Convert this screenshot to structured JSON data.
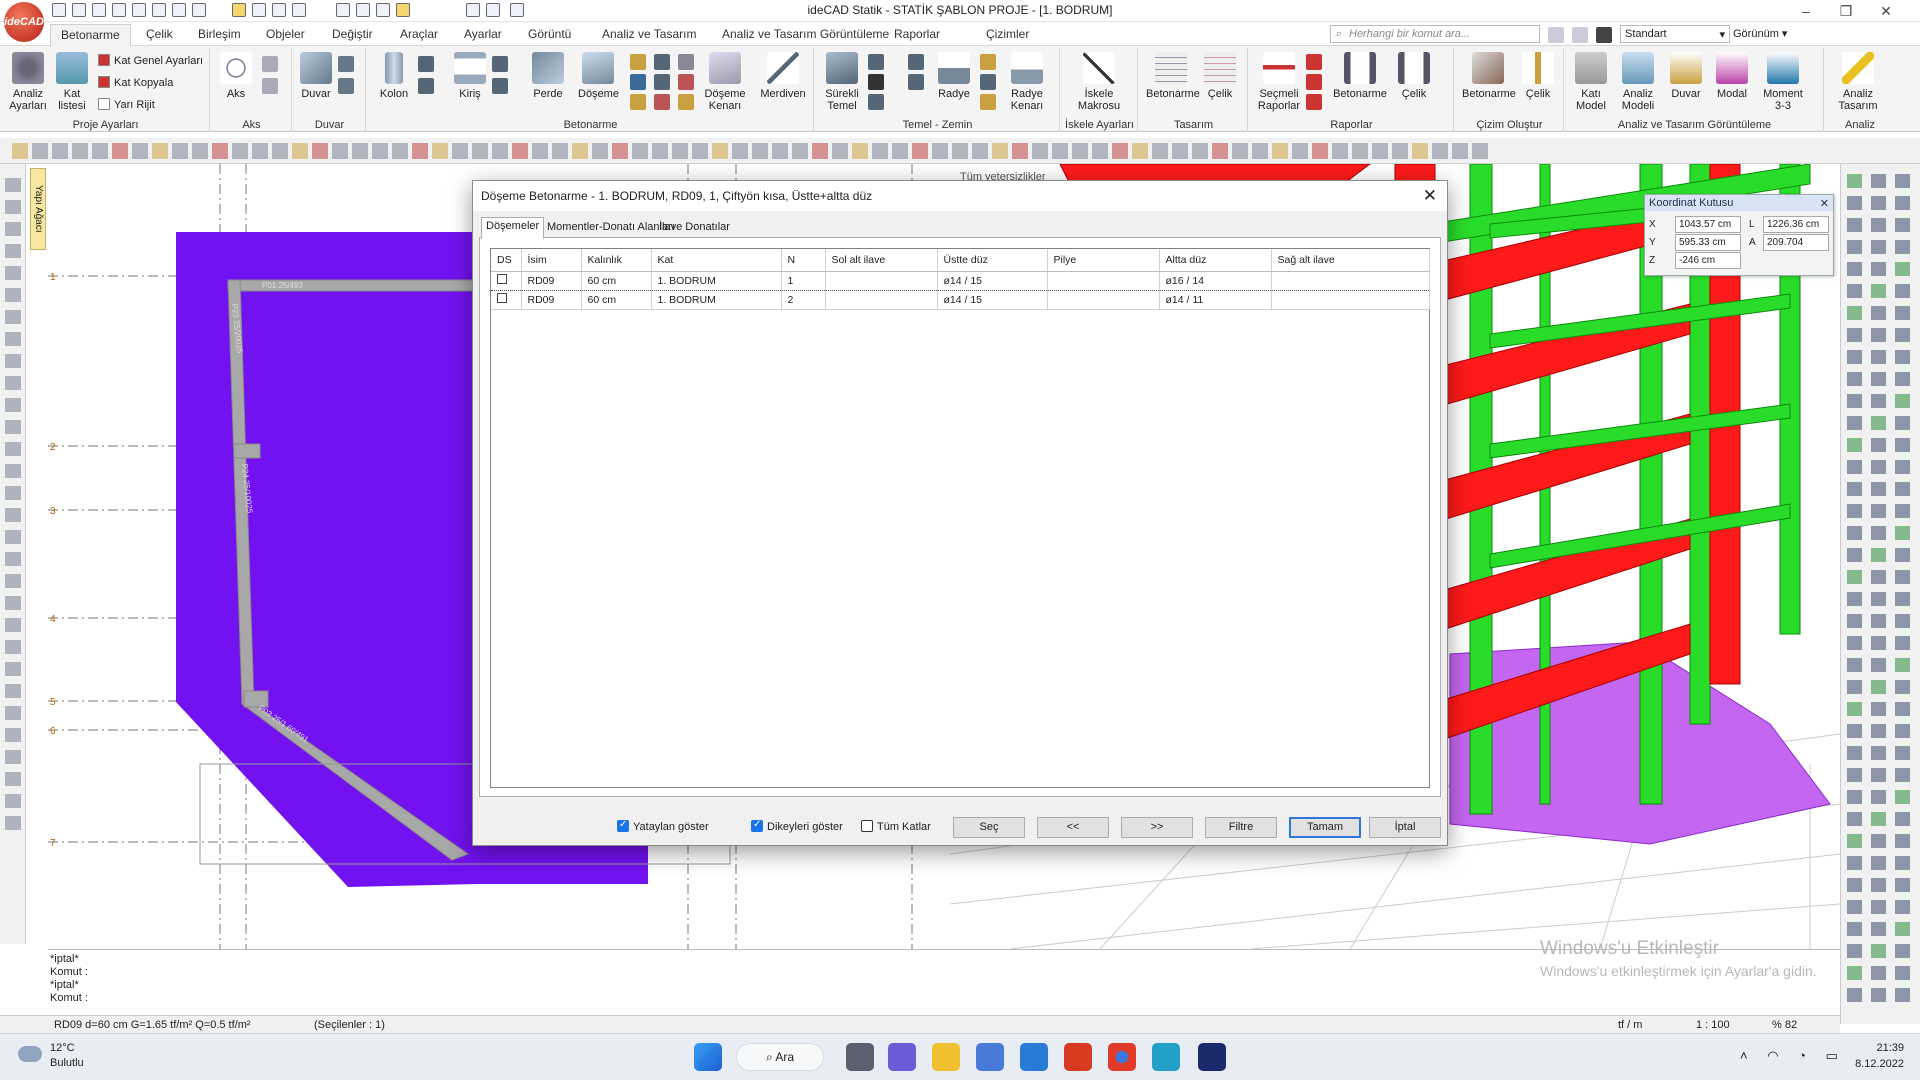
{
  "app": {
    "title": "ideCAD Statik - STATİK ŞABLON PROJE - [1. BODRUM]",
    "logo_text": "ideCAD"
  },
  "menu": {
    "tabs": [
      "Betonarme",
      "Çelik",
      "Birleşim",
      "Objeler",
      "Değiştir",
      "Araçlar",
      "Ayarlar",
      "Görüntü",
      "Analiz ve Tasarım",
      "Analiz ve Tasarım Görüntüleme",
      "Raporlar",
      "Çizimler"
    ],
    "search_placeholder": "Herhangi bir komut ara...",
    "standard_label": "Standart",
    "view_label": "Görünüm"
  },
  "ribbon": {
    "groups": {
      "proje": "Proje Ayarları",
      "aks": "Aks",
      "duvar": "Duvar",
      "betonarme": "Betonarme",
      "temel": "Temel - Zemin",
      "iskele": "İskele Ayarları",
      "tasarim": "Tasarım",
      "raporlar": "Raporlar",
      "cizim": "Çizim Oluştur",
      "goruntuleme": "Analiz ve Tasarım Görüntüleme",
      "analiz": "Analiz"
    },
    "buttons": {
      "analiz_ayarlari": "Analiz\nAyarları",
      "kat_listesi": "Kat\nlistesi",
      "kat_genel": "Kat Genel Ayarları",
      "kat_kopyala": "Kat Kopyala",
      "yari_rijit": "Yarı Rijit",
      "aks": "Aks",
      "duvar": "Duvar",
      "kolon": "Kolon",
      "kiris": "Kiriş",
      "perde": "Perde",
      "doseme": "Döşeme",
      "doseme_kenari": "Döşeme\nKenarı",
      "merdiven": "Merdiven",
      "surekli_temel": "Sürekli\nTemel",
      "radye": "Radye",
      "radye_kenari": "Radye\nKenarı",
      "iskele_makrosu": "İskele\nMakrosu",
      "betonarme_t": "Betonarme",
      "celik_t": "Çelik",
      "secmeli_raporlar": "Seçmeli\nRaporlar",
      "betonarme_r": "Betonarme",
      "celik_r": "Çelik",
      "betonarme_c": "Betonarme",
      "celik_c": "Çelik",
      "kati_model": "Katı\nModel",
      "analiz_modeli": "Analiz\nModeli",
      "duvar_g": "Duvar",
      "modal": "Modal",
      "moment": "Moment\n3-3",
      "analiz_tasarim": "Analiz\nTasarım"
    }
  },
  "left_panel": {
    "tab_label": "Yapı Ağacı"
  },
  "plan": {
    "labels": [
      "P01 25/493",
      "P23 25/20025",
      "P24 25/10025",
      "P03 25/1 60/491"
    ],
    "axes": [
      "1",
      "2",
      "3",
      "4",
      "5",
      "6",
      "7"
    ]
  },
  "view3d": {
    "header_text": "Tüm yetersizlikler"
  },
  "coord_box": {
    "title": "Koordinat Kutusu",
    "x_label": "X",
    "x_value": "1043.57 cm",
    "y_label": "Y",
    "y_value": "595.33 cm",
    "z_label": "Z",
    "z_value": "-246 cm",
    "l_label": "L",
    "l_value": "1226.36 cm",
    "a_label": "A",
    "a_value": "209.704"
  },
  "dialog": {
    "title": "Döşeme Betonarme - 1. BODRUM, RD09, 1, Çiftyön kısa, Üstte+altta düz",
    "tabs": [
      "Döşemeler",
      "Momentler-Donatı Alanları",
      "İlave Donatılar"
    ],
    "columns": [
      "DS",
      "İsim",
      "Kalınlık",
      "Kat",
      "N",
      "Sol alt ilave",
      "Üstte düz",
      "Pilye",
      "Altta düz",
      "Sağ alt ilave"
    ],
    "rows": [
      {
        "ds": "",
        "name": "RD09",
        "thickness": "60 cm",
        "floor": "1. BODRUM",
        "n": "1",
        "sol_alt": "",
        "ustte_duz": "ø14 / 15",
        "pilye": "",
        "altta_duz": "ø16 / 14",
        "sag_alt": ""
      },
      {
        "ds": "",
        "name": "RD09",
        "thickness": "60 cm",
        "floor": "1. BODRUM",
        "n": "2",
        "sol_alt": "",
        "ustte_duz": "ø14 / 15",
        "pilye": "",
        "altta_duz": "ø14 / 11",
        "sag_alt": ""
      }
    ],
    "checkboxes": {
      "yataylari": "Yataylan göster",
      "dikeyleri": "Dikeyleri göster",
      "tum_katlar": "Tüm Katlar"
    },
    "checkbox_states": {
      "yataylari": true,
      "dikeyleri": true,
      "tum_katlar": false
    },
    "buttons": {
      "sec": "Seç",
      "prev": "<<",
      "next": ">>",
      "filtre": "Filtre",
      "tamam": "Tamam",
      "iptal": "İptal"
    }
  },
  "command": {
    "lines": [
      "*iptal*",
      "Komut :",
      "*iptal*",
      "Komut :"
    ]
  },
  "status": {
    "info": "RD09 d=60 cm G=1.65 tf/m² Q=0.5 tf/m²",
    "selected": "(Seçilenler : 1)",
    "units": "tf / m",
    "scale": "1 : 100",
    "zoom": "% 82"
  },
  "watermark": {
    "line1": "Windows'u Etkinleştir",
    "line2": "Windows'u etkinleştirmek için Ayarlar'a gidin."
  },
  "taskbar": {
    "temp": "12°C",
    "weather": "Bulutlu",
    "search": "Ara",
    "time": "21:39",
    "date": "8.12.2022"
  },
  "colors": {
    "slab_purple": "#7312f0",
    "beam_red": "#ff1a1a",
    "column_green": "#1fd81f",
    "accent_blue": "#1a73e8"
  }
}
